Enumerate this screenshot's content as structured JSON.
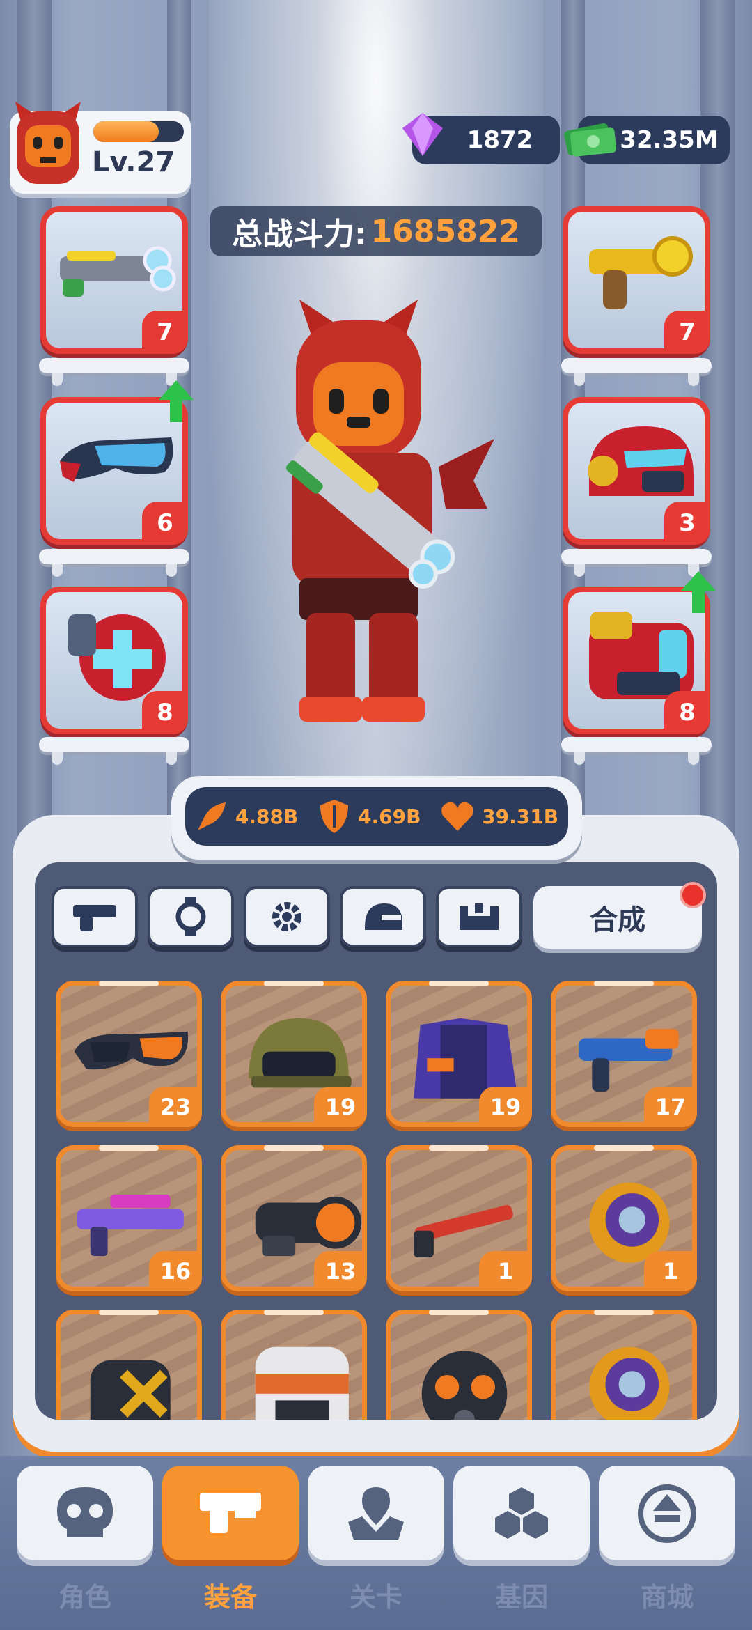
{
  "player": {
    "level": "Lv.27",
    "xp_fraction": 0.72
  },
  "currency": {
    "gems": "1872",
    "cash": "32.35M"
  },
  "power": {
    "label": "总战斗力:",
    "value": "1685822"
  },
  "equipped": {
    "left": [
      {
        "name": "blaster",
        "level": "7",
        "upgrade": false
      },
      {
        "name": "goggles",
        "level": "6",
        "upgrade": true
      },
      {
        "name": "shield-pack",
        "level": "8",
        "upgrade": false
      }
    ],
    "right": [
      {
        "name": "pistol",
        "level": "7",
        "upgrade": false
      },
      {
        "name": "helmet",
        "level": "3",
        "upgrade": false
      },
      {
        "name": "armor",
        "level": "8",
        "upgrade": true
      }
    ]
  },
  "stats": {
    "attack": "4.88B",
    "defense": "4.69B",
    "health": "39.31B"
  },
  "inventory_tabs": [
    "gun-icon",
    "watch-icon",
    "gear-icon",
    "helmet-icon",
    "armor-icon"
  ],
  "synth": {
    "label": "合成"
  },
  "inventory": [
    {
      "name": "goggles",
      "count": "23"
    },
    {
      "name": "helmet",
      "count": "19"
    },
    {
      "name": "jacket",
      "count": "19"
    },
    {
      "name": "blaster",
      "count": "17"
    },
    {
      "name": "rifle",
      "count": "16"
    },
    {
      "name": "scope",
      "count": "13"
    },
    {
      "name": "shotgun",
      "count": "1"
    },
    {
      "name": "gauntlet",
      "count": "1"
    },
    {
      "name": "ammo-pack",
      "count": ""
    },
    {
      "name": "vest",
      "count": ""
    },
    {
      "name": "gas-mask",
      "count": ""
    },
    {
      "name": "gauntlet",
      "count": ""
    }
  ],
  "nav": [
    {
      "label": "角色",
      "icon": "skull-icon",
      "active": false
    },
    {
      "label": "装备",
      "icon": "gun-icon",
      "active": true
    },
    {
      "label": "关卡",
      "icon": "map-icon",
      "active": false
    },
    {
      "label": "基因",
      "icon": "hex-icon",
      "active": false
    },
    {
      "label": "商城",
      "icon": "shop-icon",
      "active": false
    }
  ],
  "colors": {
    "accent": "#f08a2c",
    "red": "#e53b34",
    "navy": "#2c3a5b",
    "gold": "#ffa13c"
  }
}
